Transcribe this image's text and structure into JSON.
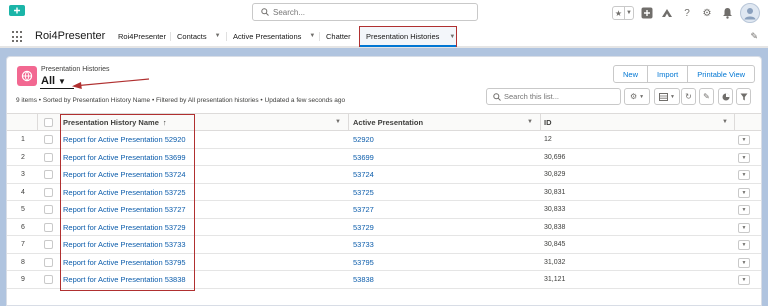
{
  "global_header": {
    "search_placeholder": "Search...",
    "icons": [
      "favorites-icon",
      "add-icon",
      "trailhead-icon",
      "help-icon",
      "setup-icon",
      "notifications-icon",
      "avatar"
    ]
  },
  "nav": {
    "app_name": "Roi4Presenter",
    "items": [
      {
        "label": "Roi4Presenter",
        "has_menu": false
      },
      {
        "label": "Contacts",
        "has_menu": true
      },
      {
        "label": "Active Presentations",
        "has_menu": true
      },
      {
        "label": "Chatter",
        "has_menu": false
      }
    ],
    "active_tab": "Presentation Histories"
  },
  "list_view": {
    "object_label": "Presentation Histories",
    "view_name": "All",
    "buttons": [
      "New",
      "Import",
      "Printable View"
    ],
    "info": "9 items • Sorted by Presentation History Name • Filtered by All presentation histories • Updated a few seconds ago",
    "search_placeholder": "Search this list..."
  },
  "table": {
    "columns": {
      "name": "Presentation History Name",
      "sort_indicator": "↑",
      "active_presentation": "Active Presentation",
      "id": "ID"
    },
    "rows": [
      {
        "num": "1",
        "name": "Report for Active Presentation 52920",
        "active_presentation": "52920",
        "id": "12"
      },
      {
        "num": "2",
        "name": "Report for Active Presentation 53699",
        "active_presentation": "53699",
        "id": "30,696"
      },
      {
        "num": "3",
        "name": "Report for Active Presentation 53724",
        "active_presentation": "53724",
        "id": "30,829"
      },
      {
        "num": "4",
        "name": "Report for Active Presentation 53725",
        "active_presentation": "53725",
        "id": "30,831"
      },
      {
        "num": "5",
        "name": "Report for Active Presentation 53727",
        "active_presentation": "53727",
        "id": "30,833"
      },
      {
        "num": "6",
        "name": "Report for Active Presentation 53729",
        "active_presentation": "53729",
        "id": "30,838"
      },
      {
        "num": "7",
        "name": "Report for Active Presentation 53733",
        "active_presentation": "53733",
        "id": "30,845"
      },
      {
        "num": "8",
        "name": "Report for Active Presentation 53795",
        "active_presentation": "53795",
        "id": "31,032"
      },
      {
        "num": "9",
        "name": "Report for Active Presentation 53838",
        "active_presentation": "53838",
        "id": "31,121"
      }
    ]
  },
  "colors": {
    "brand": "#0176d3",
    "link": "#0b5cab",
    "object_icon": "#f26891",
    "annotation": "#b03030",
    "app_logo": "#1bb5a8"
  }
}
